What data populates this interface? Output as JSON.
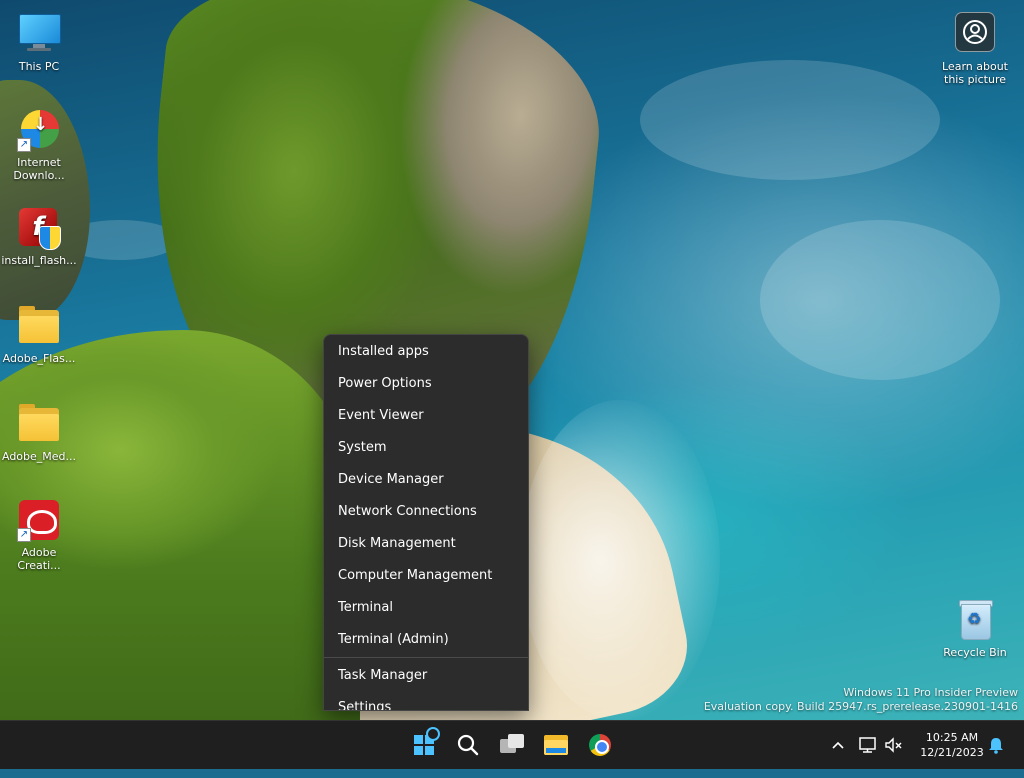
{
  "desktop": {
    "icons": [
      {
        "label": "This PC"
      },
      {
        "label": "Internet Downlo..."
      },
      {
        "label": "install_flash..."
      },
      {
        "label": "Adobe_Flas..."
      },
      {
        "label": "Adobe_Med..."
      },
      {
        "label": "Adobe Creati..."
      }
    ],
    "recycle_bin": {
      "label": "Recycle Bin"
    },
    "learn_picture": {
      "line1": "Learn about",
      "line2": "this picture"
    },
    "watermark": {
      "line1": "Windows 11 Pro Insider Preview",
      "line2": "Evaluation copy. Build 25947.rs_prerelease.230901-1416"
    }
  },
  "context_menu": {
    "items": [
      {
        "label": "Installed apps"
      },
      {
        "label": "Power Options"
      },
      {
        "label": "Event Viewer"
      },
      {
        "label": "System"
      },
      {
        "label": "Device Manager"
      },
      {
        "label": "Network Connections"
      },
      {
        "label": "Disk Management"
      },
      {
        "label": "Computer Management"
      },
      {
        "label": "Terminal"
      },
      {
        "label": "Terminal (Admin)"
      }
    ],
    "items_after_separator": [
      {
        "label": "Task Manager"
      },
      {
        "label": "Settings"
      }
    ]
  },
  "taskbar": {
    "pinned": [
      {
        "icon": "start-icon"
      },
      {
        "icon": "search-icon"
      },
      {
        "icon": "task-view-icon"
      },
      {
        "icon": "file-explorer-icon"
      },
      {
        "icon": "chrome-icon"
      }
    ],
    "tray": {
      "chevron": "^",
      "time": "10:25 AM",
      "date": "12/21/2023"
    }
  },
  "colors": {
    "menu_bg": "#2c2c2c",
    "taskbar_bg": "#1f1f1f",
    "accent": "#4cc2ff"
  }
}
